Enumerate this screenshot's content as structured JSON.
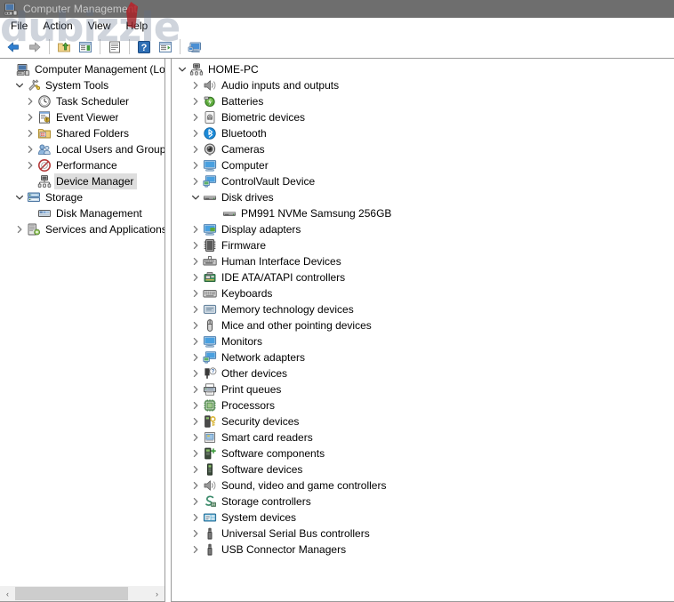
{
  "window": {
    "title": "Computer Management",
    "icon": "computer-management-icon",
    "titlebar_color": "#6e6e6e",
    "title_text_color": "#c9c9c9"
  },
  "watermark": {
    "text": "dubizzle"
  },
  "menubar": {
    "items": [
      {
        "label": "File",
        "name": "menu-file"
      },
      {
        "label": "Action",
        "name": "menu-action"
      },
      {
        "label": "View",
        "name": "menu-view"
      },
      {
        "label": "Help",
        "name": "menu-help"
      }
    ]
  },
  "toolbar": {
    "buttons": [
      {
        "icon": "back-arrow-icon",
        "name": "toolbar-back"
      },
      {
        "icon": "forward-arrow-icon",
        "name": "toolbar-forward"
      },
      {
        "icon": "up-folder-icon",
        "name": "toolbar-up-one-level"
      },
      {
        "icon": "properties-icon",
        "name": "toolbar-properties"
      },
      {
        "icon": "document-icon",
        "name": "toolbar-document"
      },
      {
        "icon": "help-icon",
        "name": "toolbar-help"
      },
      {
        "icon": "show-hide-console-tree-icon",
        "name": "toolbar-show-hide-tree"
      },
      {
        "icon": "scan-hardware-icon",
        "name": "toolbar-scan-hardware-changes"
      }
    ]
  },
  "console_tree": {
    "nodes": [
      {
        "label": "Computer Management (Local",
        "indent": 0,
        "expanded": null,
        "icon": "computer-management-icon",
        "selected": false
      },
      {
        "label": "System Tools",
        "indent": 1,
        "expanded": true,
        "icon": "system-tools-icon",
        "selected": false
      },
      {
        "label": "Task Scheduler",
        "indent": 2,
        "expanded": false,
        "icon": "clock-icon",
        "selected": false
      },
      {
        "label": "Event Viewer",
        "indent": 2,
        "expanded": false,
        "icon": "event-viewer-icon",
        "selected": false
      },
      {
        "label": "Shared Folders",
        "indent": 2,
        "expanded": false,
        "icon": "shared-folders-icon",
        "selected": false
      },
      {
        "label": "Local Users and Groups",
        "indent": 2,
        "expanded": false,
        "icon": "users-groups-icon",
        "selected": false
      },
      {
        "label": "Performance",
        "indent": 2,
        "expanded": false,
        "icon": "performance-icon",
        "selected": false
      },
      {
        "label": "Device Manager",
        "indent": 2,
        "expanded": null,
        "icon": "device-manager-icon",
        "selected": true
      },
      {
        "label": "Storage",
        "indent": 1,
        "expanded": true,
        "icon": "storage-icon",
        "selected": false
      },
      {
        "label": "Disk Management",
        "indent": 2,
        "expanded": null,
        "icon": "disk-management-icon",
        "selected": false
      },
      {
        "label": "Services and Applications",
        "indent": 1,
        "expanded": false,
        "icon": "services-apps-icon",
        "selected": false
      }
    ],
    "scrollbar": {
      "left_arrow": "‹",
      "right_arrow": "›"
    }
  },
  "device_tree": {
    "nodes": [
      {
        "label": "HOME-PC",
        "indent": 0,
        "expanded": true,
        "icon": "computer-root-icon"
      },
      {
        "label": "Audio inputs and outputs",
        "indent": 1,
        "expanded": false,
        "icon": "speaker-icon"
      },
      {
        "label": "Batteries",
        "indent": 1,
        "expanded": false,
        "icon": "battery-icon"
      },
      {
        "label": "Biometric devices",
        "indent": 1,
        "expanded": false,
        "icon": "fingerprint-icon"
      },
      {
        "label": "Bluetooth",
        "indent": 1,
        "expanded": false,
        "icon": "bluetooth-icon"
      },
      {
        "label": "Cameras",
        "indent": 1,
        "expanded": false,
        "icon": "camera-icon"
      },
      {
        "label": "Computer",
        "indent": 1,
        "expanded": false,
        "icon": "monitor-icon"
      },
      {
        "label": "ControlVault Device",
        "indent": 1,
        "expanded": false,
        "icon": "network-device-icon"
      },
      {
        "label": "Disk drives",
        "indent": 1,
        "expanded": true,
        "icon": "disk-drive-icon"
      },
      {
        "label": "PM991 NVMe Samsung 256GB",
        "indent": 2,
        "expanded": null,
        "icon": "disk-drive-icon"
      },
      {
        "label": "Display adapters",
        "indent": 1,
        "expanded": false,
        "icon": "display-adapter-icon"
      },
      {
        "label": "Firmware",
        "indent": 1,
        "expanded": false,
        "icon": "firmware-icon"
      },
      {
        "label": "Human Interface Devices",
        "indent": 1,
        "expanded": false,
        "icon": "hid-icon"
      },
      {
        "label": "IDE ATA/ATAPI controllers",
        "indent": 1,
        "expanded": false,
        "icon": "ide-controller-icon"
      },
      {
        "label": "Keyboards",
        "indent": 1,
        "expanded": false,
        "icon": "keyboard-icon"
      },
      {
        "label": "Memory technology devices",
        "indent": 1,
        "expanded": false,
        "icon": "memory-icon"
      },
      {
        "label": "Mice and other pointing devices",
        "indent": 1,
        "expanded": false,
        "icon": "mouse-icon"
      },
      {
        "label": "Monitors",
        "indent": 1,
        "expanded": false,
        "icon": "monitor-icon"
      },
      {
        "label": "Network adapters",
        "indent": 1,
        "expanded": false,
        "icon": "network-device-icon"
      },
      {
        "label": "Other devices",
        "indent": 1,
        "expanded": false,
        "icon": "unknown-device-icon"
      },
      {
        "label": "Print queues",
        "indent": 1,
        "expanded": false,
        "icon": "printer-icon"
      },
      {
        "label": "Processors",
        "indent": 1,
        "expanded": false,
        "icon": "processor-icon"
      },
      {
        "label": "Security devices",
        "indent": 1,
        "expanded": false,
        "icon": "security-device-icon"
      },
      {
        "label": "Smart card readers",
        "indent": 1,
        "expanded": false,
        "icon": "smart-card-icon"
      },
      {
        "label": "Software components",
        "indent": 1,
        "expanded": false,
        "icon": "software-component-icon"
      },
      {
        "label": "Software devices",
        "indent": 1,
        "expanded": false,
        "icon": "software-device-icon"
      },
      {
        "label": "Sound, video and game controllers",
        "indent": 1,
        "expanded": false,
        "icon": "speaker-icon"
      },
      {
        "label": "Storage controllers",
        "indent": 1,
        "expanded": false,
        "icon": "storage-controller-icon"
      },
      {
        "label": "System devices",
        "indent": 1,
        "expanded": false,
        "icon": "system-device-icon"
      },
      {
        "label": "Universal Serial Bus controllers",
        "indent": 1,
        "expanded": false,
        "icon": "usb-icon"
      },
      {
        "label": "USB Connector Managers",
        "indent": 1,
        "expanded": false,
        "icon": "usb-icon"
      }
    ]
  }
}
